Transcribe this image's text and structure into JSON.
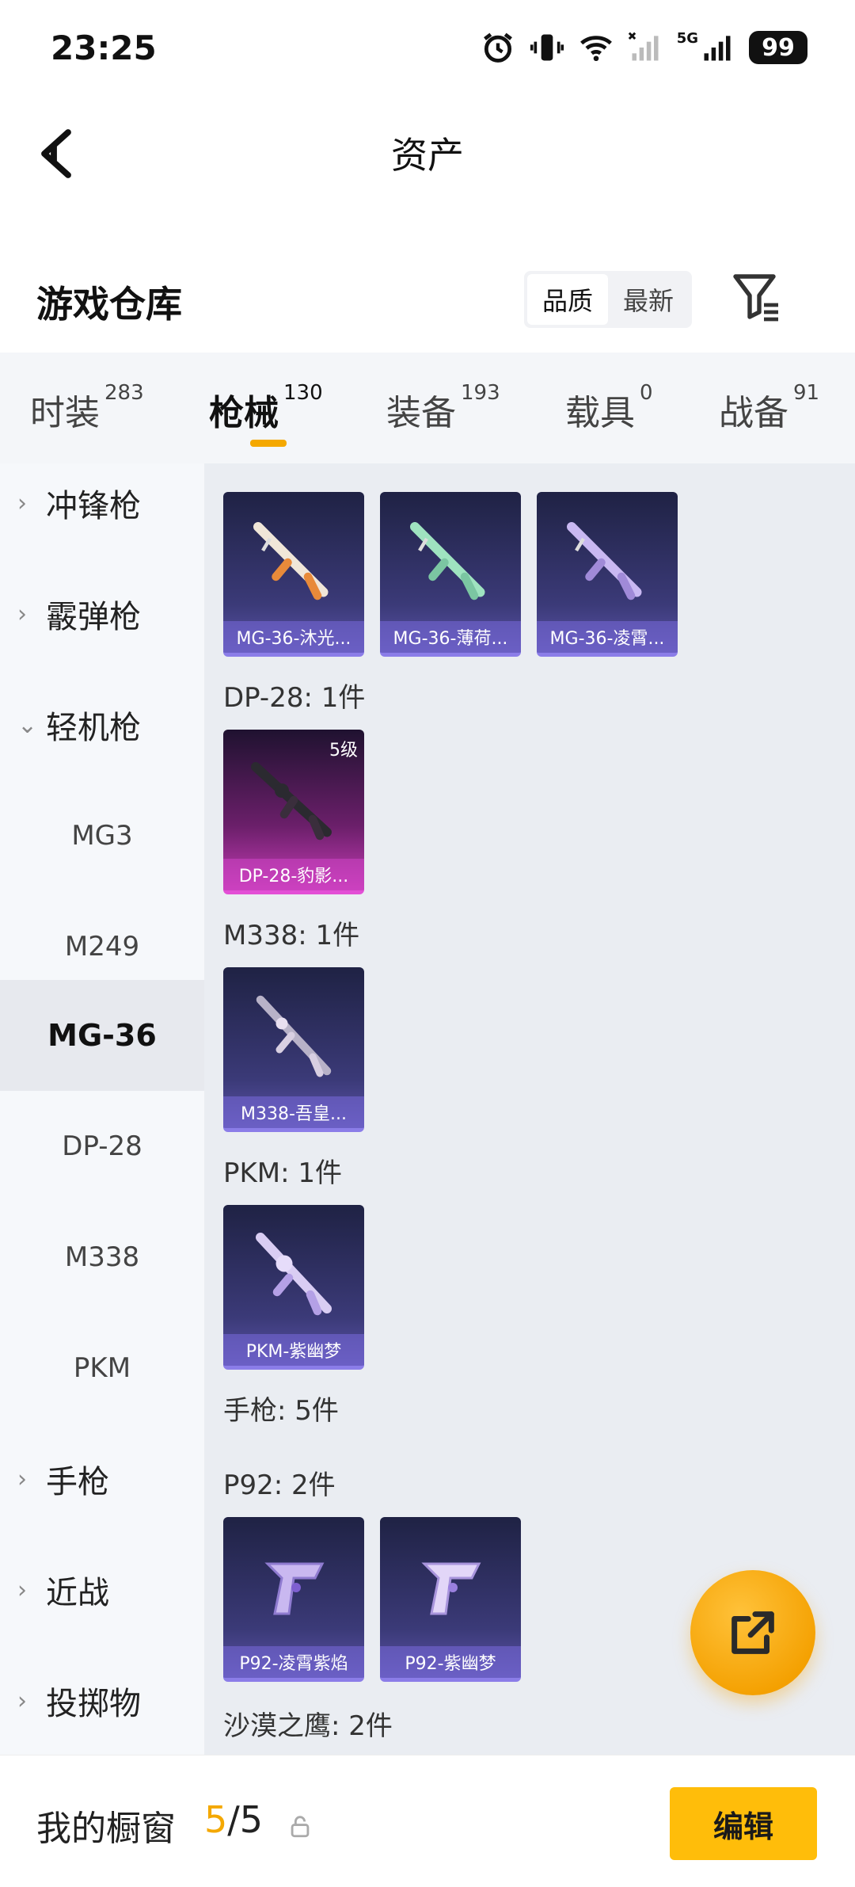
{
  "status_bar": {
    "time": "23:25",
    "network": "5G",
    "battery": "99",
    "icons": [
      "alarm-icon",
      "vibrate-icon",
      "wifi-icon",
      "signal-icon",
      "signal-5g-icon",
      "battery-icon"
    ]
  },
  "header": {
    "title": "资产",
    "back_icon": "chevron-left-icon"
  },
  "warehouse": {
    "title": "游戏仓库",
    "sort_options": [
      {
        "label": "品质",
        "selected": true
      },
      {
        "label": "最新",
        "selected": false
      }
    ],
    "filter_icon": "filter-icon"
  },
  "tabs": [
    {
      "label": "时装",
      "count": "283",
      "active": false
    },
    {
      "label": "枪械",
      "count": "130",
      "active": true
    },
    {
      "label": "装备",
      "count": "193",
      "active": false
    },
    {
      "label": "载具",
      "count": "0",
      "active": false
    },
    {
      "label": "战备",
      "count": "91",
      "active": false
    }
  ],
  "subnav": [
    {
      "label": "冲锋枪",
      "type": "category",
      "expanded": false
    },
    {
      "label": "霰弹枪",
      "type": "category",
      "expanded": false
    },
    {
      "label": "轻机枪",
      "type": "category",
      "expanded": true
    },
    {
      "label": "MG3",
      "type": "item",
      "active": false
    },
    {
      "label": "M249",
      "type": "item",
      "active": false
    },
    {
      "label": "MG-36",
      "type": "item",
      "active": true
    },
    {
      "label": "DP-28",
      "type": "item",
      "active": false
    },
    {
      "label": "M338",
      "type": "item",
      "active": false
    },
    {
      "label": "PKM",
      "type": "item",
      "active": false
    },
    {
      "label": "手枪",
      "type": "category",
      "expanded": false
    },
    {
      "label": "近战",
      "type": "category",
      "expanded": false
    },
    {
      "label": "投掷物",
      "type": "category",
      "expanded": false
    }
  ],
  "content": {
    "mg36_cards": [
      {
        "label": "MG-36-沐光...",
        "rarity": "blue"
      },
      {
        "label": "MG-36-薄荷...",
        "rarity": "blue"
      },
      {
        "label": "MG-36-凌霄...",
        "rarity": "blue"
      }
    ],
    "dp28_title": "DP-28: 1件",
    "dp28_cards": [
      {
        "label": "DP-28-豹影...",
        "rarity": "purple",
        "level": "5级"
      }
    ],
    "m338_title": "M338: 1件",
    "m338_cards": [
      {
        "label": "M338-吾皇...",
        "rarity": "blue"
      }
    ],
    "pkm_title": "PKM: 1件",
    "pkm_cards": [
      {
        "label": "PKM-紫幽梦",
        "rarity": "blue"
      }
    ],
    "pistol_title": "手枪: 5件",
    "p92_title": "P92: 2件",
    "p92_cards": [
      {
        "label": "P92-凌霄紫焰",
        "rarity": "blue"
      },
      {
        "label": "P92-紫幽梦",
        "rarity": "blue"
      }
    ],
    "deagle_title": "沙漠之鹰: 2件"
  },
  "fab": {
    "icon": "share-external-icon"
  },
  "bottom_bar": {
    "showcase_label": "我的橱窗",
    "showcase_count": "5",
    "showcase_slash": "/",
    "showcase_max": "5",
    "lock_icon": "lock-icon",
    "edit_label": "编辑"
  },
  "colors": {
    "accent": "#f4a800",
    "blue_card": "#3b3a78",
    "purple_card": "#c53cb5"
  }
}
